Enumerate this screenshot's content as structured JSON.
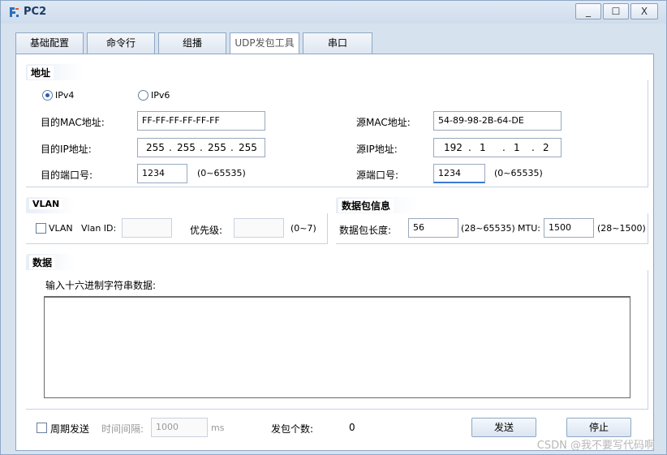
{
  "window": {
    "title": "PC2",
    "min": "_",
    "max": "☐",
    "close": "X"
  },
  "tabs": [
    "基础配置",
    "命令行",
    "组播",
    "UDP发包工具",
    "串口"
  ],
  "address": {
    "legend": "地址",
    "ipv4": "IPv4",
    "ipv6": "IPv6",
    "dst_mac_label": "目的MAC地址:",
    "dst_mac": "FF-FF-FF-FF-FF-FF",
    "src_mac_label": "源MAC地址:",
    "src_mac": "54-89-98-2B-64-DE",
    "dst_ip_label": "目的IP地址:",
    "dst_ip": [
      "255",
      "255",
      "255",
      "255"
    ],
    "src_ip_label": "源IP地址:",
    "src_ip": [
      "192",
      "1",
      "1",
      "2"
    ],
    "dot": ".",
    "dst_port_label": "目的端口号:",
    "dst_port": "1234",
    "dst_port_range": "(0~65535)",
    "src_port_label": "源端口号:",
    "src_port": "1234",
    "src_port_range": "(0~65535)"
  },
  "vlan": {
    "legend": "VLAN",
    "checkbox_label": "VLAN",
    "vlan_id_label": "Vlan ID:",
    "priority_label": "优先级:",
    "priority_range": "(0~7)"
  },
  "packet": {
    "legend": "数据包信息",
    "length_label": "数据包长度:",
    "length": "56",
    "length_range": "(28~65535)",
    "mtu_label": "MTU:",
    "mtu": "1500",
    "mtu_range": "(28~1500)"
  },
  "data": {
    "legend": "数据",
    "hex_label": "输入十六进制字符串数据:"
  },
  "bottom": {
    "periodic_label": "周期发送",
    "interval_label": "时间间隔:",
    "interval": "1000",
    "interval_unit": "ms",
    "count_label": "发包个数:",
    "count": "0",
    "send": "发送",
    "stop": "停止"
  },
  "watermark": "CSDN @我不要写代码啊",
  "colors": {
    "window_bg": "#d7e2ef",
    "border": "#8ea7c4",
    "radio_dot": "#1f5fbf"
  }
}
